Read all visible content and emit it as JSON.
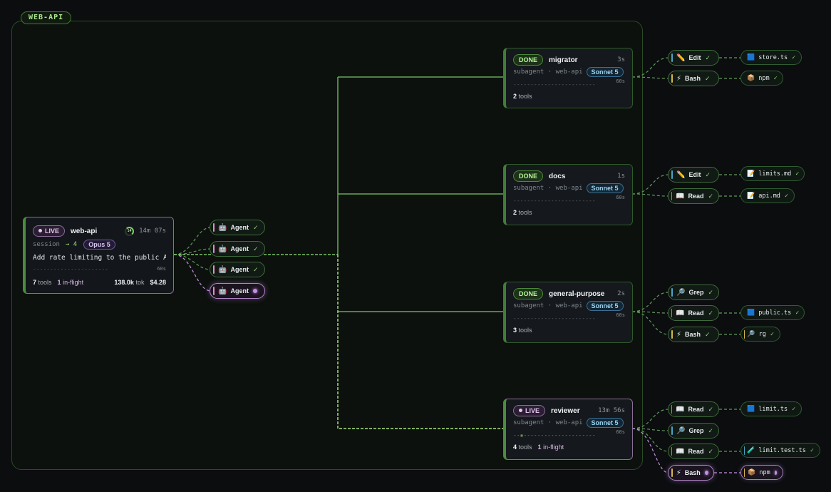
{
  "group": {
    "label": "WEB-API"
  },
  "root": {
    "badge": "LIVE",
    "name": "web-api",
    "ring_value": "14",
    "elapsed": "14m 07s",
    "session_label": "session",
    "session_value": "→ 4",
    "model": "Opus 5",
    "prompt": "Add rate limiting to the public A…",
    "dash": "----------------------",
    "scale": "60s",
    "tools_count": "7",
    "tools_label": "tools",
    "inflight_count": "1",
    "inflight_label": "in-flight",
    "tokens": "138.0k",
    "tokens_unit": "tok",
    "cost": "$4.28"
  },
  "agent_pills": [
    {
      "label": "Agent",
      "icon": "🤖",
      "status": "✓"
    },
    {
      "label": "Agent",
      "icon": "🤖",
      "status": "✓"
    },
    {
      "label": "Agent",
      "icon": "🤖",
      "status": "✓"
    },
    {
      "label": "Agent",
      "icon": "🤖",
      "status": "running"
    }
  ],
  "subagents": [
    {
      "badge": "DONE",
      "name": "migrator",
      "elapsed": "3s",
      "meta": "subagent · web-api",
      "model": "Sonnet 5",
      "dash": "------------------------",
      "scale": "60s",
      "tools_count": "2",
      "tools_label": "tools",
      "tools": [
        {
          "label": "Edit",
          "icon": "✏️",
          "bar": "#4ea1c7",
          "status": "✓",
          "file": "store.ts",
          "file_icon": "🟦"
        },
        {
          "label": "Bash",
          "icon": "⚡",
          "bar": "#d6b64a",
          "status": "✓",
          "file": "npm",
          "file_icon": "📦"
        }
      ]
    },
    {
      "badge": "DONE",
      "name": "docs",
      "elapsed": "1s",
      "meta": "subagent · web-api",
      "model": "Sonnet 5",
      "dash": "------------------------",
      "scale": "60s",
      "tools_count": "2",
      "tools_label": "tools",
      "tools": [
        {
          "label": "Edit",
          "icon": "✏️",
          "bar": "#4ea1c7",
          "status": "✓",
          "file": "limits.md",
          "file_icon": "📝"
        },
        {
          "label": "Read",
          "icon": "📖",
          "bar": "#4ea1c7",
          "status": "✓",
          "file": "api.md",
          "file_icon": "📝"
        }
      ]
    },
    {
      "badge": "DONE",
      "name": "general-purpose",
      "elapsed": "2s",
      "meta": "subagent · web-api",
      "model": "Sonnet 5",
      "dash": "------------------------",
      "scale": "60s",
      "tools_count": "3",
      "tools_label": "tools",
      "tools": [
        {
          "label": "Grep",
          "icon": "🔎",
          "bar": "#4ea1c7",
          "status": "✓",
          "file": "",
          "file_icon": ""
        },
        {
          "label": "Read",
          "icon": "📖",
          "bar": "#4ea1c7",
          "status": "✓",
          "file": "public.ts",
          "file_icon": "🟦"
        },
        {
          "label": "Bash",
          "icon": "⚡",
          "bar": "#d6b64a",
          "status": "✓",
          "file": "rg",
          "file_icon": "🔎"
        }
      ]
    },
    {
      "badge": "LIVE",
      "name": "reviewer",
      "elapsed": "13m 56s",
      "meta": "subagent · web-api",
      "model": "Sonnet 5",
      "dash": "--▪---------------------",
      "scale": "60s",
      "tools_count": "4",
      "tools_label": "tools",
      "inflight_count": "1",
      "inflight_label": "in-flight",
      "tools": [
        {
          "label": "Read",
          "icon": "📖",
          "bar": "#4ea1c7",
          "status": "✓",
          "file": "limit.ts",
          "file_icon": "🟦"
        },
        {
          "label": "Grep",
          "icon": "🔎",
          "bar": "#4ea1c7",
          "status": "✓",
          "file": "",
          "file_icon": ""
        },
        {
          "label": "Read",
          "icon": "📖",
          "bar": "#4ea1c7",
          "status": "✓",
          "file": "limit.test.ts",
          "file_icon": "🧪"
        },
        {
          "label": "Bash",
          "icon": "⚡",
          "bar": "#d6b64a",
          "status": "running",
          "file": "npm",
          "file_icon": "📦"
        }
      ]
    }
  ]
}
